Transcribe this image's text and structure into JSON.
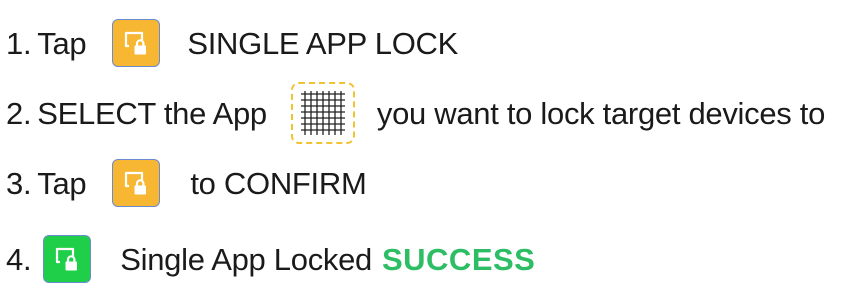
{
  "steps": [
    {
      "number": "1.",
      "verb": "Tap",
      "icon": "single-app-lock-icon",
      "text": "SINGLE APP LOCK"
    },
    {
      "number": "2.",
      "verb": "SELECT the App",
      "icon": "app-grid-icon",
      "text": "you want to lock target devices to"
    },
    {
      "number": "3.",
      "verb": "Tap",
      "icon": "single-app-lock-icon",
      "text": "to CONFIRM"
    },
    {
      "number": "4.",
      "icon": "single-app-locked-icon",
      "text": "Single App Locked",
      "status": "SUCCESS"
    }
  ],
  "colors": {
    "lock_button": "#f7b733",
    "lock_button_success": "#1fcf4a",
    "button_border": "#6a8ccf",
    "app_outline": "#f1c232",
    "success_text": "#2dbd64",
    "text": "#1a1a1a"
  }
}
